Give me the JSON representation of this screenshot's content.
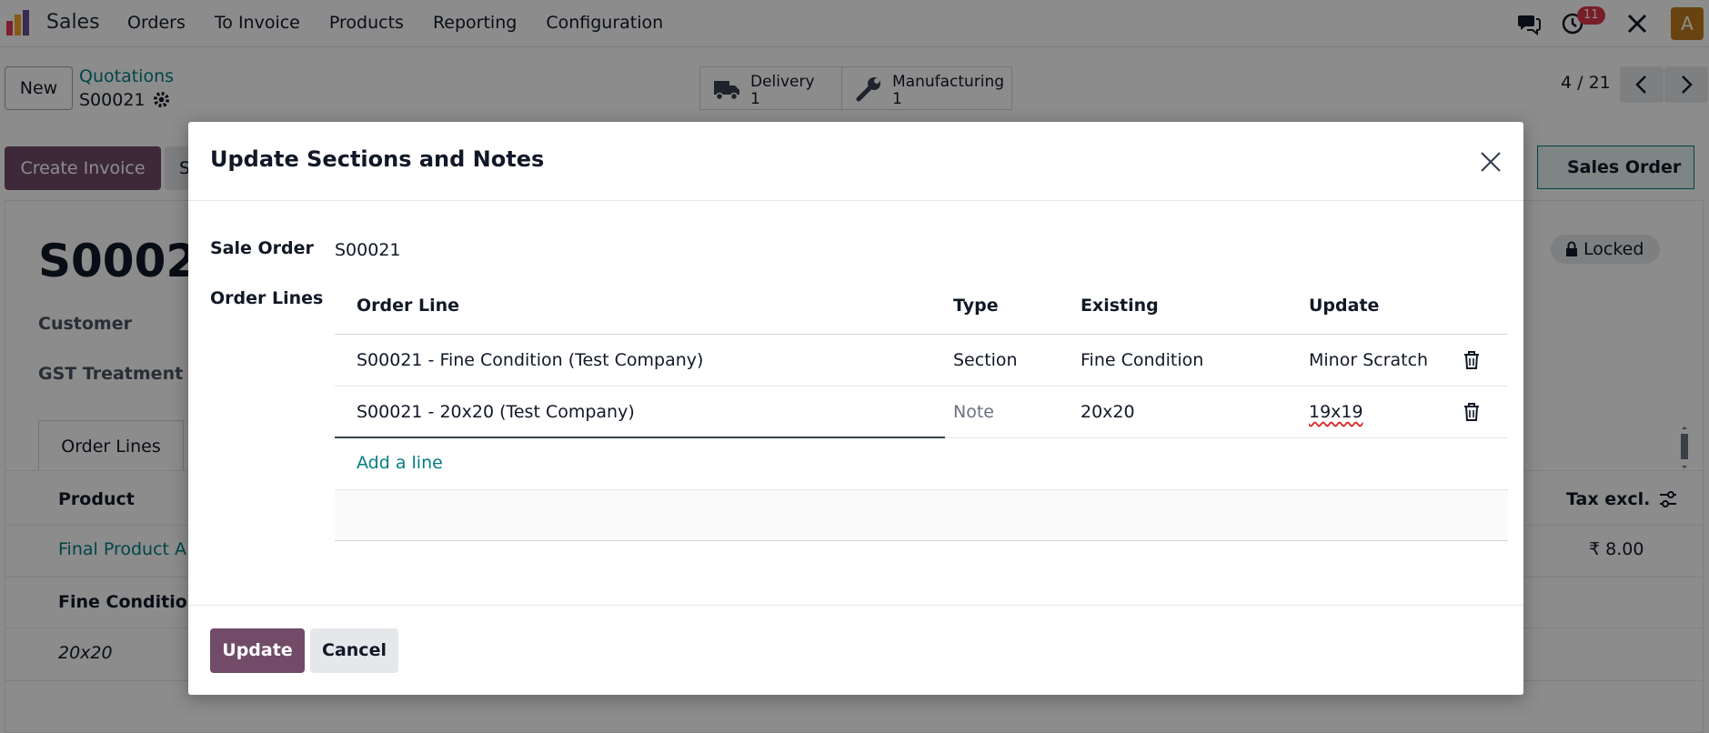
{
  "app": {
    "name": "Sales",
    "menu": [
      "Orders",
      "To Invoice",
      "Products",
      "Reporting",
      "Configuration"
    ],
    "notification_count": "11",
    "avatar_letter": "A"
  },
  "control_panel": {
    "new_label": "New",
    "breadcrumb_parent": "Quotations",
    "breadcrumb_current": "S00021",
    "smart_buttons": [
      {
        "label": "Delivery",
        "count": "1",
        "icon": "truck-icon"
      },
      {
        "label": "Manufacturing",
        "count": "1",
        "icon": "wrench-icon"
      }
    ],
    "pager": "4 / 21"
  },
  "actions": {
    "create_invoice": "Create Invoice",
    "partial_button": "S",
    "status": "Sales Order"
  },
  "form": {
    "title": "S00021",
    "locked_label": "Locked",
    "customer_label": "Customer",
    "gst_label": "GST Treatment",
    "tab_order_lines": "Order Lines",
    "col_product": "Product",
    "col_tax_excl": "Tax excl.",
    "line_product": "Final Product A",
    "line_section": "Fine Condition",
    "line_note": "20x20",
    "line_price": "₹ 8.00"
  },
  "modal": {
    "title": "Update Sections and Notes",
    "sale_order_label": "Sale Order",
    "sale_order_value": "S00021",
    "order_lines_label": "Order Lines",
    "columns": [
      "Order Line",
      "Type",
      "Existing",
      "Update"
    ],
    "rows": [
      {
        "order_line": "S00021 - Fine Condition (Test Company)",
        "type": "Section",
        "existing": "Fine Condition",
        "update": "Minor Scratch"
      },
      {
        "order_line": "S00021 - 20x20 (Test Company)",
        "type": "Note",
        "existing": "20x20",
        "update": "19x19"
      }
    ],
    "add_line": "Add a line",
    "update_button": "Update",
    "cancel_button": "Cancel"
  },
  "colors": {
    "brand": "#714b67",
    "link": "#017e84"
  }
}
